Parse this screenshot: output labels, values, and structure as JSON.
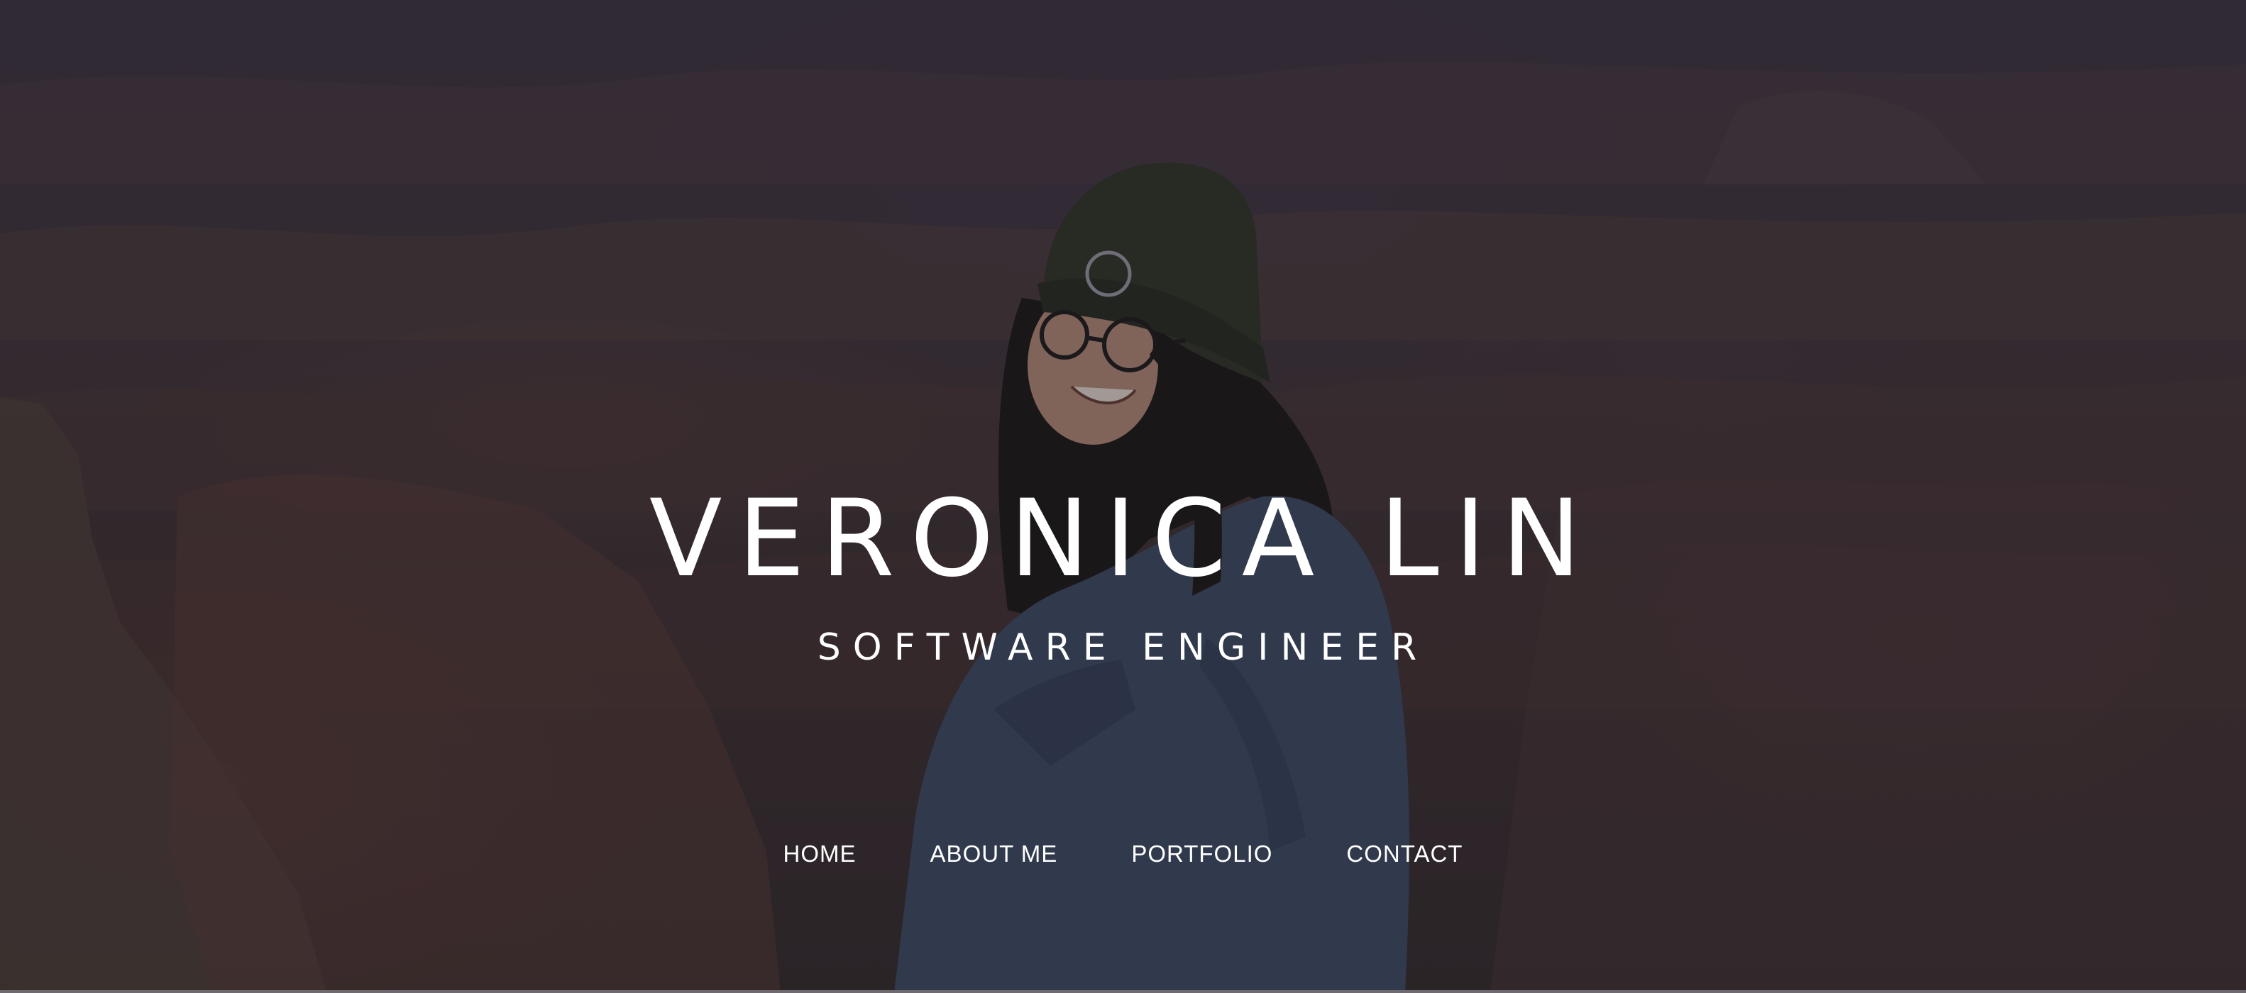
{
  "hero": {
    "name": "VERONICA LIN",
    "subtitle": "SOFTWARE ENGINEER"
  },
  "nav": {
    "items": [
      {
        "label": "HOME"
      },
      {
        "label": "ABOUT ME"
      },
      {
        "label": "PORTFOLIO"
      },
      {
        "label": "CONTACT"
      }
    ]
  },
  "colors": {
    "text": "#ffffff",
    "overlay": "#1e1a20"
  }
}
